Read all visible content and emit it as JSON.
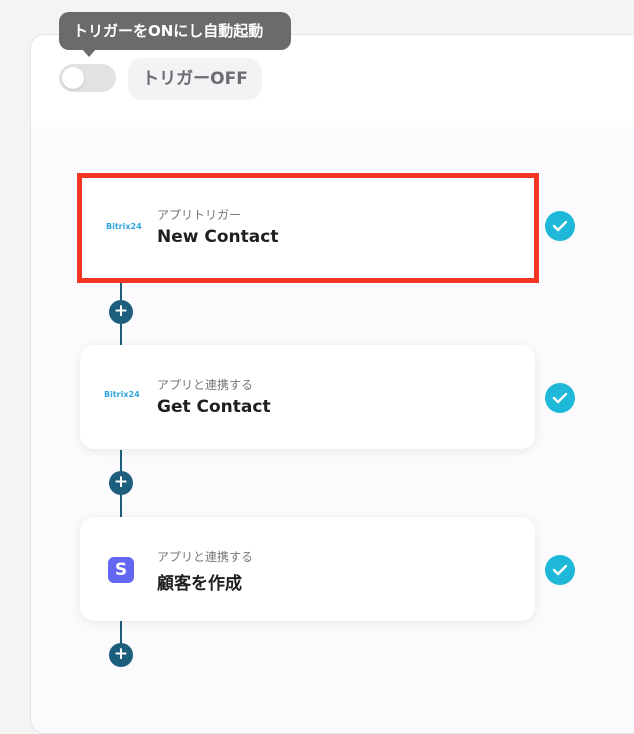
{
  "header": {
    "tooltip": "トリガーをONにし自動起動",
    "toggle_state": "off",
    "status_label": "トリガーOFF"
  },
  "flow": {
    "steps": [
      {
        "label": "アプリトリガー",
        "title": "New Contact",
        "app_logo": "Bitrix24",
        "icon": "bitrix24-logo",
        "highlighted": true,
        "completed": true
      },
      {
        "label": "アプリと連携する",
        "title": "Get Contact",
        "app_logo": "Bitrix24",
        "icon": "bitrix24-logo",
        "highlighted": false,
        "completed": true
      },
      {
        "label": "アプリと連携する",
        "title": "顧客を作成",
        "app_logo": "S",
        "icon": "stripe-logo",
        "highlighted": false,
        "completed": true
      }
    ],
    "add_button_symbol": "+"
  },
  "colors": {
    "accent": "#1d5d7d",
    "check": "#1fb8d9",
    "highlight_border": "#f03523",
    "stripe": "#6366f1",
    "bitrix": "#2ea3dc"
  }
}
